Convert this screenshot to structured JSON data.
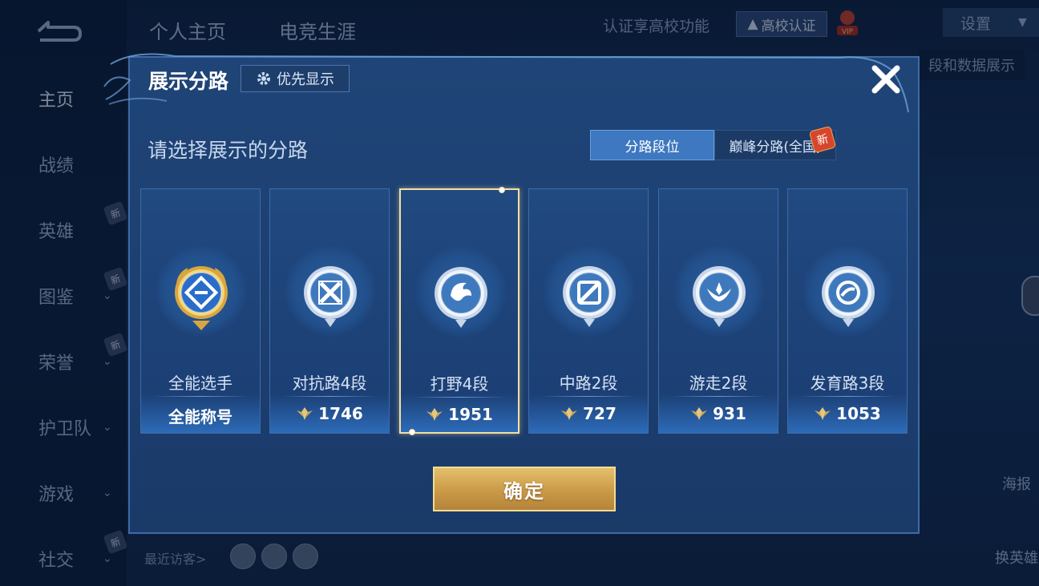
{
  "background": {
    "sidebar": [
      {
        "label": "主页",
        "active": true,
        "chevron": false,
        "new": false
      },
      {
        "label": "战绩",
        "active": false,
        "chevron": false,
        "new": false
      },
      {
        "label": "英雄",
        "active": false,
        "chevron": false,
        "new": true
      },
      {
        "label": "图鉴",
        "active": false,
        "chevron": true,
        "new": true
      },
      {
        "label": "荣誉",
        "active": false,
        "chevron": true,
        "new": true
      },
      {
        "label": "护卫队",
        "active": false,
        "chevron": true,
        "new": false
      },
      {
        "label": "游戏",
        "active": false,
        "chevron": true,
        "new": false
      },
      {
        "label": "社交",
        "active": false,
        "chevron": true,
        "new": true
      }
    ],
    "new_badge": "新",
    "top_tabs": [
      "个人主页",
      "电竞生涯"
    ],
    "top_hint": "认证享高校功能",
    "cert_button": "高校认证",
    "settings_button": "设置",
    "tooltip": "段和数据展示",
    "recent_visitors": "最近访客>",
    "right_buttons": [
      "海报",
      "换英雄"
    ]
  },
  "dialog": {
    "title": "展示分路",
    "priority_button": "优先显示",
    "subtitle": "请选择展示的分路",
    "segments": [
      {
        "label": "分路段位",
        "active": true
      },
      {
        "label": "巅峰分路(全国)",
        "active": false,
        "new": "新"
      }
    ],
    "cards": [
      {
        "name": "全能选手",
        "value": "全能称号",
        "selected": false,
        "emblem": "all-round-emblem-icon",
        "show_score_icon": false
      },
      {
        "name": "对抗路4段",
        "value": "1746",
        "selected": false,
        "emblem": "clash-lane-emblem-icon",
        "show_score_icon": true
      },
      {
        "name": "打野4段",
        "value": "1951",
        "selected": true,
        "emblem": "jungle-emblem-icon",
        "show_score_icon": true
      },
      {
        "name": "中路2段",
        "value": "727",
        "selected": false,
        "emblem": "mid-lane-emblem-icon",
        "show_score_icon": true
      },
      {
        "name": "游走2段",
        "value": "931",
        "selected": false,
        "emblem": "roam-emblem-icon",
        "show_score_icon": true
      },
      {
        "name": "发育路3段",
        "value": "1053",
        "selected": false,
        "emblem": "farm-lane-emblem-icon",
        "show_score_icon": true
      }
    ],
    "confirm_button": "确定",
    "colors": {
      "gold": "#e4bf6d",
      "accent_blue": "#3d78c0",
      "selected_border": "#f2dfa2"
    }
  }
}
